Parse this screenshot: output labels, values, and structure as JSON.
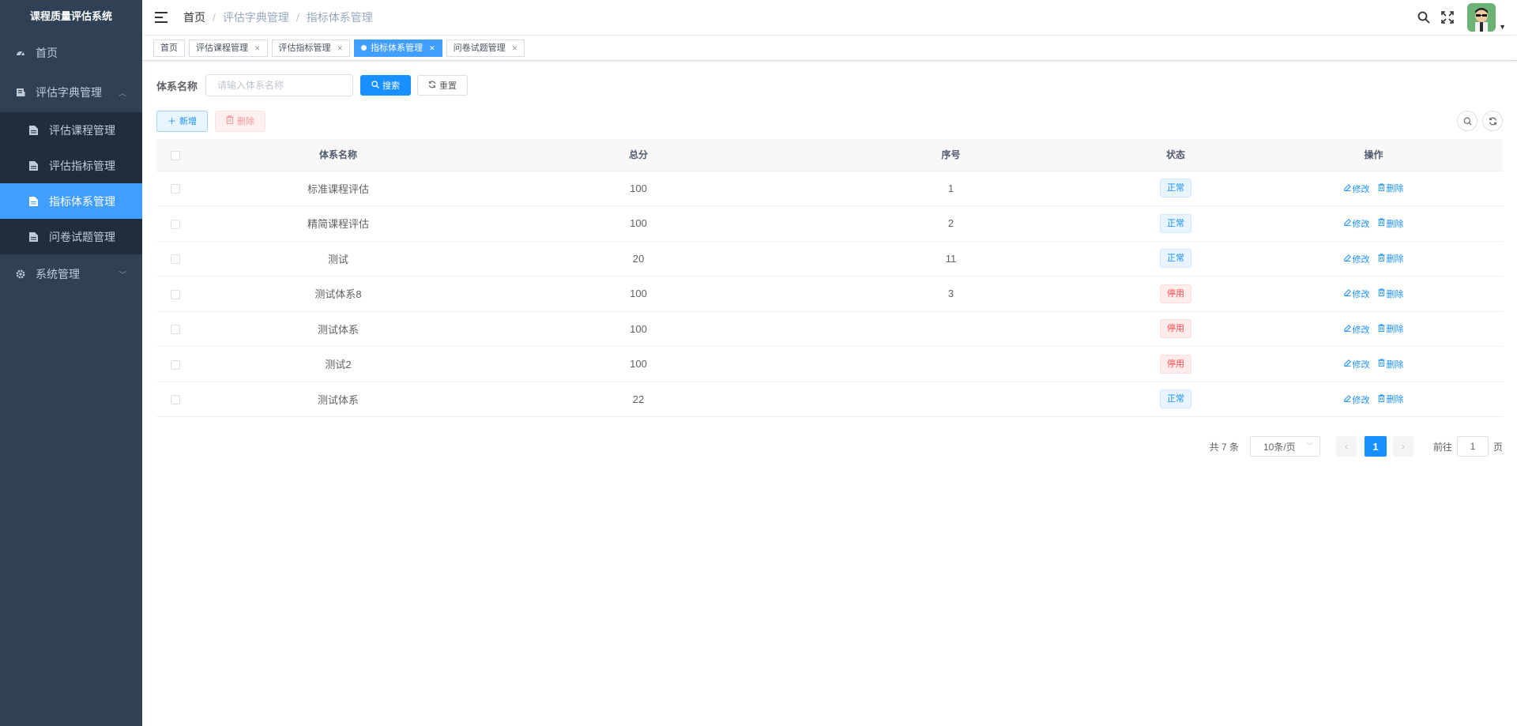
{
  "app": {
    "title": "课程质量评估系统"
  },
  "sidebar": {
    "items": [
      {
        "label": "首页",
        "icon": "dashboard-icon"
      },
      {
        "label": "评估字典管理",
        "icon": "dictionary-icon",
        "expanded": true,
        "children": [
          {
            "label": "评估课程管理",
            "icon": "document-icon"
          },
          {
            "label": "评估指标管理",
            "icon": "document-icon"
          },
          {
            "label": "指标体系管理",
            "icon": "document-icon",
            "active": true
          },
          {
            "label": "问卷试题管理",
            "icon": "document-icon"
          }
        ]
      },
      {
        "label": "系统管理",
        "icon": "gear-icon",
        "expanded": false
      }
    ]
  },
  "breadcrumb": {
    "home": "首页",
    "level1": "评估字典管理",
    "current": "指标体系管理"
  },
  "tags": [
    {
      "label": "首页"
    },
    {
      "label": "评估课程管理"
    },
    {
      "label": "评估指标管理"
    },
    {
      "label": "指标体系管理",
      "active": true
    },
    {
      "label": "问卷试题管理"
    }
  ],
  "search": {
    "label": "体系名称",
    "placeholder": "请输入体系名称",
    "value": "",
    "search_button": "搜索",
    "reset_button": "重置"
  },
  "toolbar": {
    "add_button": "新增",
    "delete_button": "删除"
  },
  "table": {
    "columns": [
      "体系名称",
      "总分",
      "序号",
      "状态",
      "操作"
    ],
    "rows": [
      {
        "name": "标准课程评估",
        "score": "100",
        "order": "1",
        "status": "正常"
      },
      {
        "name": "精简课程评估",
        "score": "100",
        "order": "2",
        "status": "正常"
      },
      {
        "name": "测试",
        "score": "20",
        "order": "11",
        "status": "正常"
      },
      {
        "name": "测试体系8",
        "score": "100",
        "order": "3",
        "status": "停用"
      },
      {
        "name": "测试体系",
        "score": "100",
        "order": "",
        "status": "停用"
      },
      {
        "name": "测试2",
        "score": "100",
        "order": "",
        "status": "停用"
      },
      {
        "name": "测试体系",
        "score": "22",
        "order": "",
        "status": "正常"
      }
    ],
    "edit_label": "修改",
    "delete_label": "删除"
  },
  "pagination": {
    "total": "共 7 条",
    "page_size": "10条/页",
    "current_page": "1",
    "goto_label": "前往",
    "goto_value": "1",
    "page_unit": "页"
  },
  "colors": {
    "primary": "#1890ff",
    "sidebar": "#304156",
    "active_menu": "#409eff",
    "danger": "#ff4949"
  }
}
